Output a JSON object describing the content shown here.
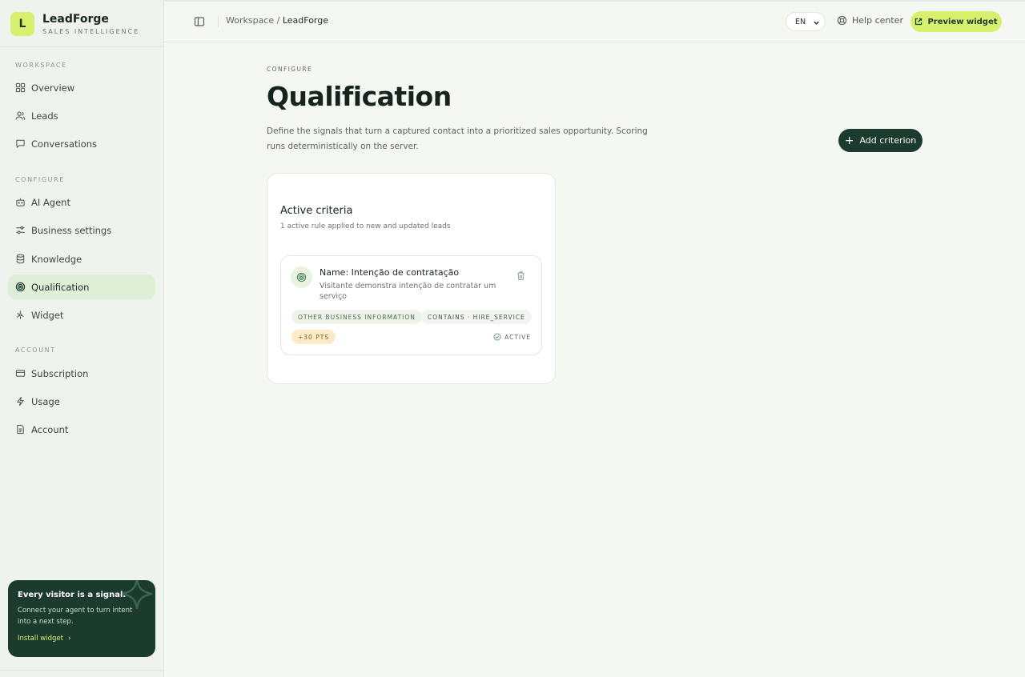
{
  "brand": {
    "logo_letter": "L",
    "name": "LeadForge",
    "tagline": "SALES INTELLIGENCE"
  },
  "sidebar": {
    "sections": [
      {
        "label": "WORKSPACE",
        "items": [
          {
            "label": "Overview",
            "icon": "grid-icon"
          },
          {
            "label": "Leads",
            "icon": "users-icon"
          },
          {
            "label": "Conversations",
            "icon": "chat-icon"
          }
        ]
      },
      {
        "label": "CONFIGURE",
        "items": [
          {
            "label": "AI Agent",
            "icon": "bot-icon"
          },
          {
            "label": "Business settings",
            "icon": "sliders-icon"
          },
          {
            "label": "Knowledge",
            "icon": "database-icon"
          },
          {
            "label": "Qualification",
            "icon": "target-icon",
            "active": true
          },
          {
            "label": "Widget",
            "icon": "widget-icon"
          }
        ]
      },
      {
        "label": "ACCOUNT",
        "items": [
          {
            "label": "Subscription",
            "icon": "card-icon"
          },
          {
            "label": "Usage",
            "icon": "bolt-icon"
          },
          {
            "label": "Account",
            "icon": "document-icon"
          }
        ]
      }
    ],
    "promo": {
      "title": "Every visitor is a signal.",
      "text": "Connect your agent to turn intent into a next step.",
      "link": "Install widget"
    }
  },
  "header": {
    "breadcrumb_root": "Workspace",
    "breadcrumb_sep": " / ",
    "breadcrumb_current": "LeadForge",
    "language": "EN",
    "help": "Help center",
    "preview": "Preview widget"
  },
  "page": {
    "eyebrow": "CONFIGURE",
    "title": "Qualification",
    "description": "Define the signals that turn a captured contact into a prioritized sales opportunity. Scoring runs deterministically on the server.",
    "add_button": "Add criterion"
  },
  "criteria_card": {
    "title": "Active criteria",
    "subtitle": "1 active rule applied to new and updated leads",
    "items": [
      {
        "name": "Name: Intenção de contratação",
        "description": "Visitante demonstra intenção de contratar um serviço",
        "field_tag": "OTHER BUSINESS INFORMATION",
        "rule_tag": "CONTAINS · HIRE_SERVICE",
        "points": "+30 PTS",
        "status": "ACTIVE"
      }
    ]
  },
  "colors": {
    "accent_lime": "#d9f06f",
    "dark_green": "#1c3b2f",
    "active_nav_bg": "#dfeed6",
    "page_bg": "#f5f7f3"
  }
}
